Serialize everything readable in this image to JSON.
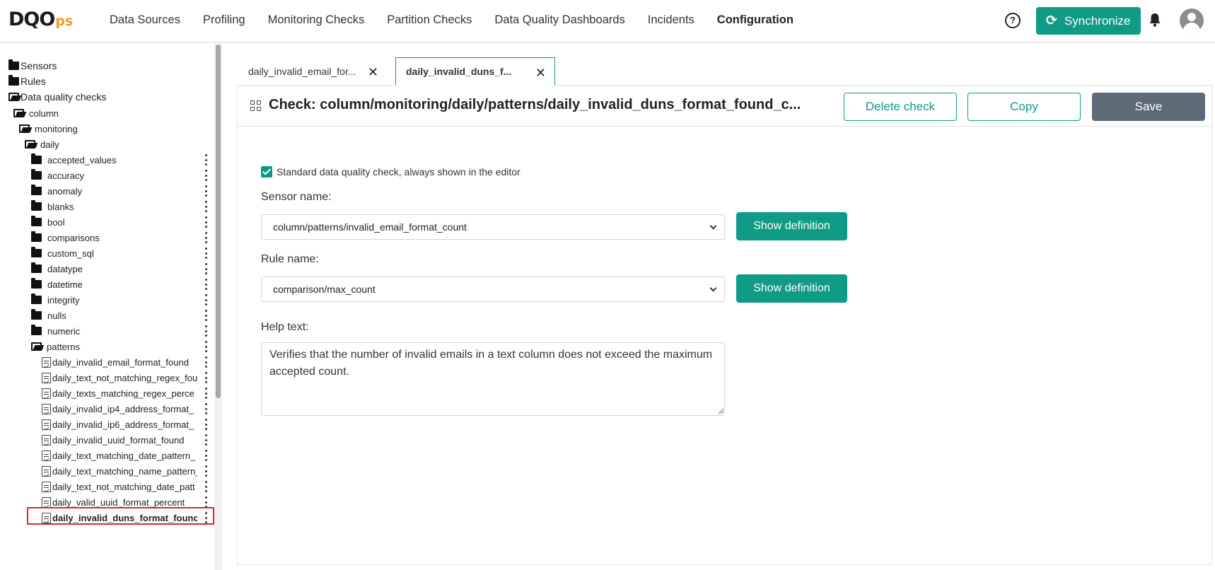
{
  "app": {
    "logo_main": "DQO",
    "logo_ps": "ps"
  },
  "nav": {
    "items": [
      "Data Sources",
      "Profiling",
      "Monitoring Checks",
      "Partition Checks",
      "Data Quality Dashboards",
      "Incidents",
      "Configuration"
    ],
    "active": "Configuration"
  },
  "header_actions": {
    "help_icon": "?",
    "sync_label": "Synchronize",
    "sync_icon": "⟳"
  },
  "sidebar": {
    "top_items": [
      "Sensors",
      "Rules",
      "Data quality checks"
    ],
    "column": "column",
    "monitoring": "monitoring",
    "daily": "daily",
    "categories": [
      "accepted_values",
      "accuracy",
      "anomaly",
      "blanks",
      "bool",
      "comparisons",
      "custom_sql",
      "datatype",
      "datetime",
      "integrity",
      "nulls",
      "numeric",
      "patterns"
    ],
    "pattern_checks": [
      "daily_invalid_email_format_found",
      "daily_text_not_matching_regex_fou",
      "daily_texts_matching_regex_perce",
      "daily_invalid_ip4_address_format_",
      "daily_invalid_ip6_address_format_",
      "daily_invalid_uuid_format_found",
      "daily_text_matching_date_pattern_",
      "daily_text_matching_name_pattern_",
      "daily_text_not_matching_date_patt",
      "daily_valid_uuid_format_percent",
      "daily_invalid_duns_format_founc"
    ],
    "selected_check": "daily_invalid_duns_format_founc"
  },
  "tabs": [
    {
      "label": "daily_invalid_email_for...",
      "active": false
    },
    {
      "label": "daily_invalid_duns_f...",
      "active": true
    }
  ],
  "check_editor": {
    "title": "Check: column/monitoring/daily/patterns/daily_invalid_duns_format_found_c...",
    "delete_label": "Delete check",
    "copy_label": "Copy",
    "save_label": "Save",
    "standard_label": "Standard data quality check, always shown in the editor",
    "standard_checked": true,
    "sensor_label": "Sensor name:",
    "sensor_value": "column/patterns/invalid_email_format_count",
    "rule_label": "Rule name:",
    "rule_value": "comparison/max_count",
    "show_definition_label": "Show definition",
    "help_label": "Help text:",
    "help_text": "Verifies that the number of invalid emails in a text column does not exceed the maximum accepted count."
  },
  "colors": {
    "accent": "#109b87",
    "save": "#5d6b78",
    "selection_outline": "#d62b2b",
    "logo_ps": "#f29b21"
  }
}
